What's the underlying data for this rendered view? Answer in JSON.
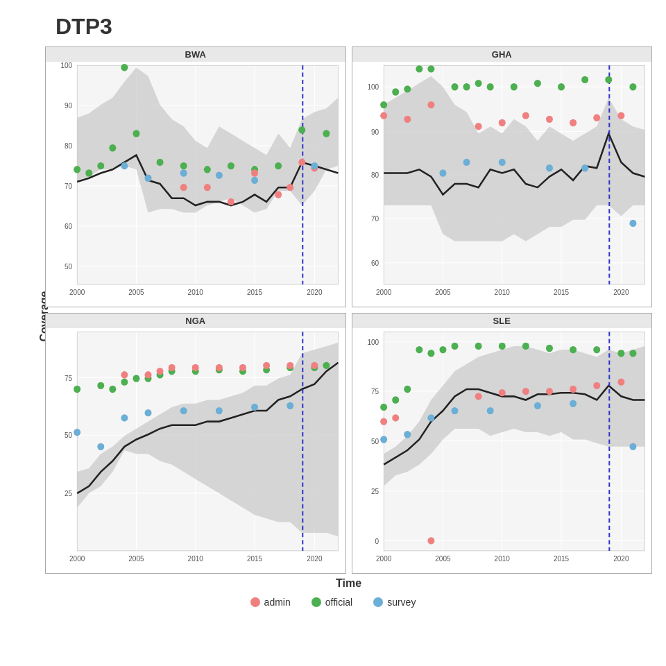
{
  "title": "DTP3",
  "y_axis_label": "Coverage",
  "x_axis_label": "Time",
  "legend": {
    "items": [
      {
        "label": "admin",
        "color": "#f08080",
        "name": "admin"
      },
      {
        "label": "official",
        "color": "#4caf50",
        "name": "official"
      },
      {
        "label": "survey",
        "color": "#6baed6",
        "name": "survey"
      }
    ]
  },
  "panels": [
    {
      "title": "BWA",
      "y_min": 50,
      "y_max": 105,
      "x_min": 2000,
      "x_max": 2022,
      "y_ticks": [
        50,
        60,
        70,
        80,
        90,
        100
      ],
      "x_ticks": [
        2000,
        2005,
        2010,
        2015,
        2020
      ],
      "dashed_x": 2019
    },
    {
      "title": "GHA",
      "y_min": 55,
      "y_max": 105,
      "x_min": 2000,
      "x_max": 2022,
      "y_ticks": [
        60,
        70,
        80,
        90,
        100
      ],
      "x_ticks": [
        2000,
        2005,
        2010,
        2015,
        2020
      ],
      "dashed_x": 2019
    },
    {
      "title": "NGA",
      "y_min": 0,
      "y_max": 95,
      "x_min": 2000,
      "x_max": 2022,
      "y_ticks": [
        25,
        50,
        75
      ],
      "x_ticks": [
        2000,
        2005,
        2010,
        2015,
        2020
      ],
      "dashed_x": 2019
    },
    {
      "title": "SLE",
      "y_min": -5,
      "y_max": 105,
      "x_min": 2000,
      "x_max": 2022,
      "y_ticks": [
        0,
        25,
        50,
        75,
        100
      ],
      "x_ticks": [
        2000,
        2005,
        2010,
        2015,
        2020
      ],
      "dashed_x": 2019
    }
  ]
}
